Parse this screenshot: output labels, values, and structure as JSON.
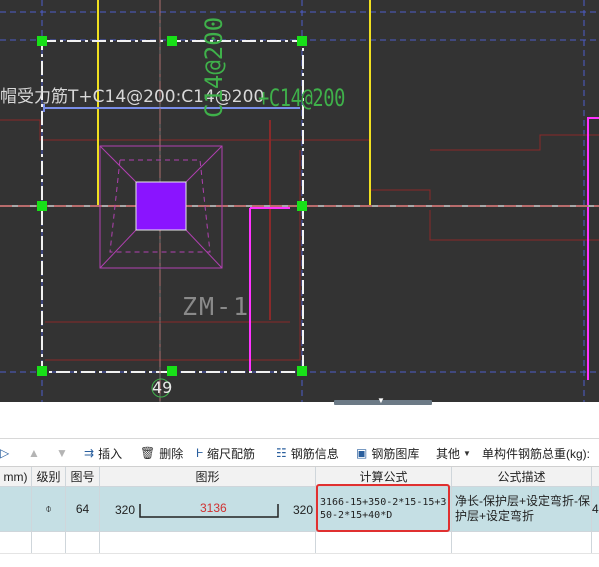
{
  "canvas": {
    "label_top": "帽受力筋T+C14@200:C14@200",
    "label_c14_right": "+C14@200",
    "label_c14_vertical": "C14@200",
    "label_zm": "ZM-1",
    "axis_label": "49"
  },
  "toolbar": {
    "insert": "插入",
    "delete": "删除",
    "scale_rebar": "缩尺配筋",
    "rebar_info": "钢筋信息",
    "rebar_library": "钢筋图库",
    "other": "其他",
    "total_weight": "单构件钢筋总重(kg):"
  },
  "grid": {
    "headers": {
      "dia_unit": "mm)",
      "grade": "级别",
      "fig_no": "图号",
      "shape": "图形",
      "formula": "计算公式",
      "formula_desc": "公式描述"
    },
    "row": {
      "grade_symbol": "⌽",
      "fig_no": "64",
      "shape_left": "320",
      "shape_mid": "3136",
      "shape_right": "320",
      "formula": "3166-15+350-2*15-15+350-2*15+40*D",
      "formula_desc": "净长-保护层+设定弯折-保护层+设定弯折",
      "overflow": "4"
    }
  },
  "colors": {
    "canvas_bg": "#333333",
    "selected_row": "#c5dfe4",
    "highlight": "#e03030",
    "shape_mid_text": "#d03030",
    "column_fill": "#8a14ff"
  }
}
